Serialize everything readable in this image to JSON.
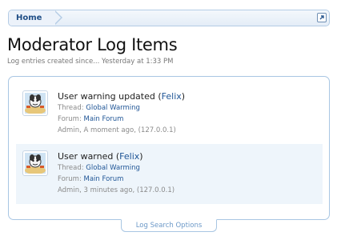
{
  "breadcrumb": {
    "home_label": "Home"
  },
  "page": {
    "title": "Moderator Log Items",
    "subtitle": "Log entries created since... Yesterday at 1:33 PM"
  },
  "items": [
    {
      "title_prefix": "User warning updated (",
      "user": "Felix",
      "title_suffix": ")",
      "thread_label": "Thread:",
      "thread": "Global Warming",
      "forum_label": "Forum:",
      "forum": "Main Forum",
      "meta": "Admin, A moment ago, (127.0.0.1)"
    },
    {
      "title_prefix": "User warned (",
      "user": "Felix",
      "title_suffix": ")",
      "thread_label": "Thread:",
      "thread": "Global Warming",
      "forum_label": "Forum:",
      "forum": "Main Forum",
      "meta": "Admin, 3 minutes ago, (127.0.0.1)"
    }
  ],
  "footer": {
    "search_options_label": "Log Search Options"
  },
  "icons": {
    "jump": "external-link-icon",
    "avatar": "cartoon-avatar-icon"
  },
  "colors": {
    "link": "#1f5596",
    "border": "#a8c6e3",
    "selected_row": "#eef5fb"
  }
}
